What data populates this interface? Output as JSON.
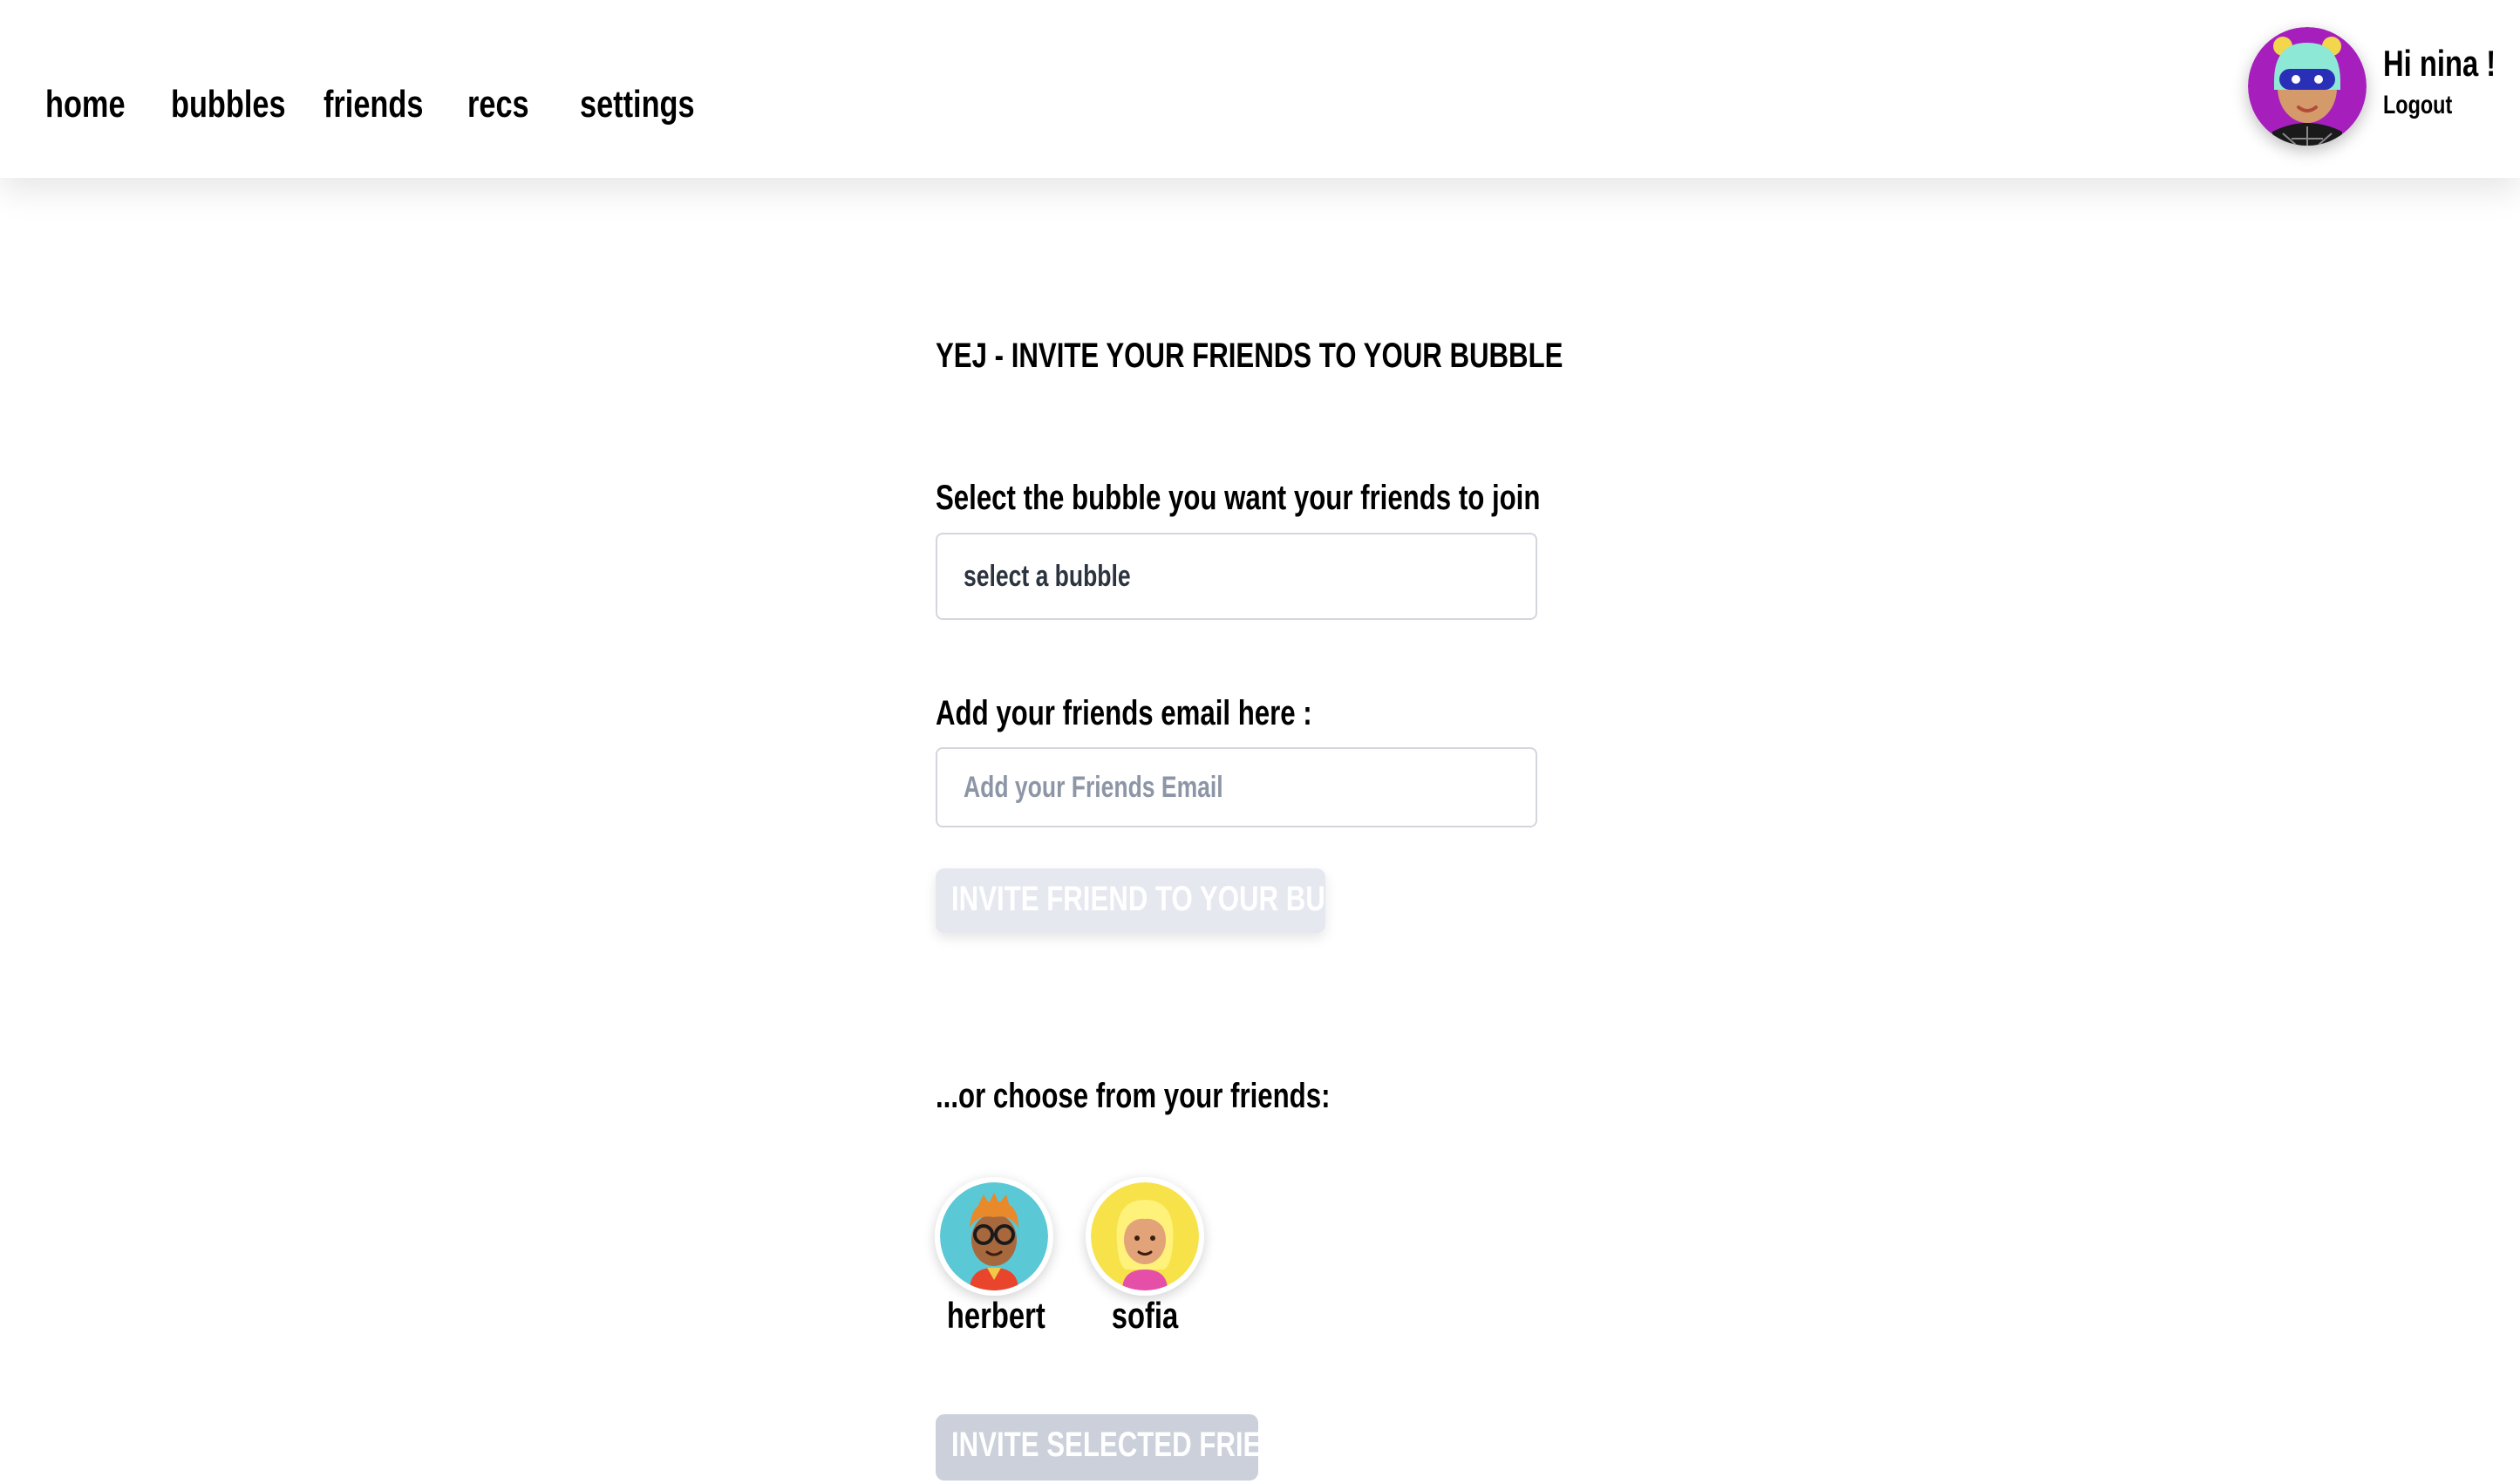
{
  "nav": {
    "items": [
      {
        "label": "home"
      },
      {
        "label": "bubbles"
      },
      {
        "label": "friends"
      },
      {
        "label": "recs"
      },
      {
        "label": "settings"
      }
    ]
  },
  "user": {
    "greeting": "Hi nina !",
    "logout_label": "Logout",
    "avatar_color": "#a61fbd"
  },
  "main": {
    "title": "YEJ - INVITE YOUR FRIENDS TO YOUR BUBBLE",
    "bubble_select": {
      "label": "Select the bubble you want your friends to join",
      "value": "select a bubble"
    },
    "email": {
      "label": "Add your friends email here :",
      "placeholder": "Add your Friends Email"
    },
    "invite_email_button": "INVITE FRIEND TO YOUR BUBBLE",
    "friends_heading": "...or choose from your friends:",
    "friends": [
      {
        "name": "herbert",
        "avatar_color": "#5bc8d6"
      },
      {
        "name": "sofia",
        "avatar_color": "#f7e24a"
      }
    ],
    "invite_selected_button": "INVITE SELECTED FRIENDS"
  },
  "colors": {
    "button_disabled_light": "#e6e8f0",
    "button_disabled_gray": "#cbd0da",
    "field_border": "#d3d6dc"
  }
}
